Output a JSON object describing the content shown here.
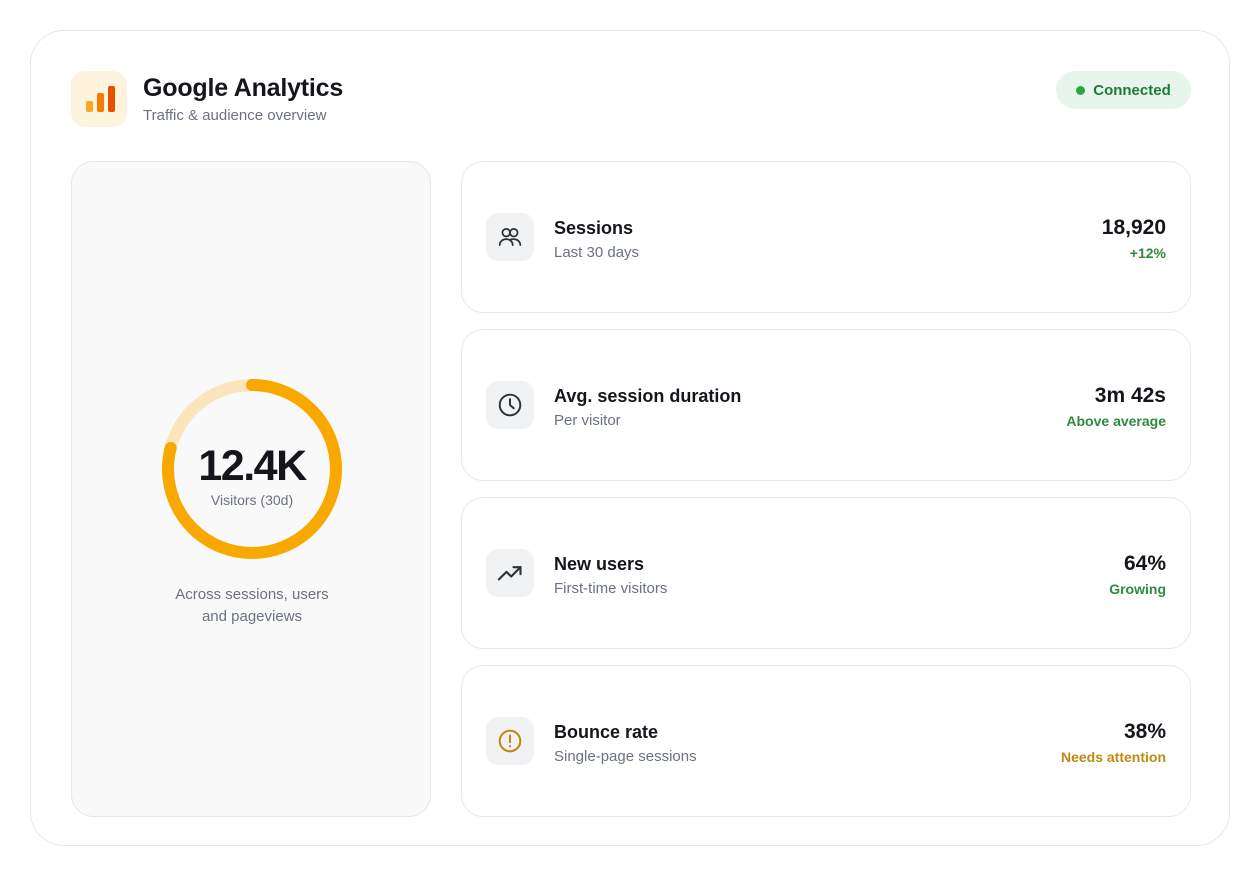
{
  "header": {
    "title": "Google Analytics",
    "subtitle": "Traffic & audience overview",
    "logo_icon": "analytics-bars-icon",
    "status": {
      "label": "Connected",
      "color": "#28a745"
    }
  },
  "summary": {
    "value": "12.4K",
    "label": "Visitors (30d)",
    "caption_line1": "Across sessions, users",
    "caption_line2": "and pageviews",
    "gauge_fill_fraction": 0.79,
    "gauge_color": "#f9a800",
    "gauge_track_color": "#fbe5bd"
  },
  "metrics": [
    {
      "icon": "users-icon",
      "title": "Sessions",
      "subtitle": "Last 30 days",
      "value": "18,920",
      "trend": "+12%",
      "trend_status": "good"
    },
    {
      "icon": "clock-icon",
      "title": "Avg. session duration",
      "subtitle": "Per visitor",
      "value": "3m 42s",
      "trend": "Above average",
      "trend_status": "good"
    },
    {
      "icon": "trending-up-icon",
      "title": "New users",
      "subtitle": "First-time visitors",
      "value": "64%",
      "trend": "Growing",
      "trend_status": "good"
    },
    {
      "icon": "alert-circle-icon",
      "title": "Bounce rate",
      "subtitle": "Single-page sessions",
      "value": "38%",
      "trend": "Needs attention",
      "trend_status": "warn"
    }
  ],
  "colors": {
    "good": "#2e8b3e",
    "warn": "#c08a10",
    "accent": "#f9a800"
  }
}
